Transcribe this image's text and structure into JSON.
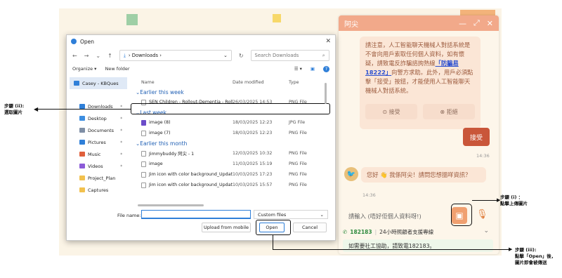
{
  "chat": {
    "title": "阿尖",
    "controls": [
      "—",
      "⤢",
      "✕"
    ],
    "notice_before": "請注意，人工智能聊天機械人對話系統是不會向用戶索取任何個人資料，如有懷疑，請致電反詐騙諮詢熱線",
    "notice_link": "「防騙易18222」",
    "notice_after": "向警方求助。此外，用戶必須點擊「接受」按鈕，才能使用人工智能聊天機械人對話系統。",
    "accept_pill": "接受",
    "reject_pill": "拒絕",
    "accept_button": "接受",
    "time1": "14:36",
    "greeting": "您好 👋 我係阿尖！請問您想搵咩資訊？",
    "time2": "14:36",
    "input_placeholder": "請輸入 (唔好佢個人資料呀!)",
    "hotline_number": "182183",
    "hotline_text": "24小時照顧者支援專線",
    "social_worker": "如需要社工協助，請致電182183。",
    "accent_color": "#f2a98a",
    "accept_color": "#c9563a"
  },
  "dialog": {
    "title": "Open",
    "path": "Downloads",
    "search_placeholder": "Search Downloads",
    "organize": "Organize ▾",
    "new_folder": "New folder",
    "sidebar": [
      {
        "label": "Casey - KBQues",
        "icon": "cloud-icon",
        "color": "#2f7fd8",
        "selected": true
      },
      {
        "label": "Downloads",
        "icon": "download-icon",
        "color": "#2f7fd8"
      },
      {
        "label": "Desktop",
        "icon": "desktop-icon",
        "color": "#3d8ee0"
      },
      {
        "label": "Documents",
        "icon": "documents-icon",
        "color": "#7f8fa6"
      },
      {
        "label": "Pictures",
        "icon": "pictures-icon",
        "color": "#2f7fd8"
      },
      {
        "label": "Music",
        "icon": "music-icon",
        "color": "#e0603c"
      },
      {
        "label": "Videos",
        "icon": "videos-icon",
        "color": "#8c5bd8"
      },
      {
        "label": "Project_Plan",
        "icon": "folder-icon",
        "color": "#f2c14e"
      },
      {
        "label": "Captures",
        "icon": "folder-icon",
        "color": "#f2c14e"
      }
    ],
    "columns": {
      "name": "Name",
      "date": "Date modified",
      "type": "Type"
    },
    "groups": [
      {
        "label": "Earlier this week",
        "files": [
          {
            "name": "SEN Children - Rollout-Dementia - Rollo...",
            "date": "26/03/2025 14:53",
            "type": "PNG File",
            "icon": "file-icon"
          }
        ]
      },
      {
        "label": "Last week",
        "files": [
          {
            "name": "image (8)",
            "date": "18/03/2025 12:23",
            "type": "JPG File",
            "icon": "image-icon"
          },
          {
            "name": "image (7)",
            "date": "18/03/2025 12:23",
            "type": "PNG File",
            "icon": "file-icon"
          }
        ]
      },
      {
        "label": "Earlier this month",
        "files": [
          {
            "name": "Jimmybuddy 阿尖 - 1",
            "date": "12/03/2025 10:32",
            "type": "PNG File",
            "icon": "file-icon"
          },
          {
            "name": "image",
            "date": "11/03/2025 15:19",
            "type": "PNG File",
            "icon": "file-icon"
          },
          {
            "name": "Jim icon with color background_Updated...",
            "date": "10/03/2025 17:23",
            "type": "PNG File",
            "icon": "file-icon"
          },
          {
            "name": "Jim icon with color background_Updated",
            "date": "10/03/2025 15:57",
            "type": "PNG File",
            "icon": "file-icon"
          }
        ]
      }
    ],
    "file_name_label": "File name:",
    "file_name_value": "",
    "file_type": "Custom files",
    "upload_mobile": "Upload from mobile",
    "open": "Open",
    "cancel": "Cancel"
  },
  "annotations": {
    "step2": [
      "步驟 (ii):",
      "選取圖片"
    ],
    "step1": [
      "步驟 (i) ：",
      "點擊上傳圖片"
    ],
    "step3": [
      "步驟 (iii):",
      "點擊「Open」後，",
      "圖片即會被傳送"
    ]
  }
}
